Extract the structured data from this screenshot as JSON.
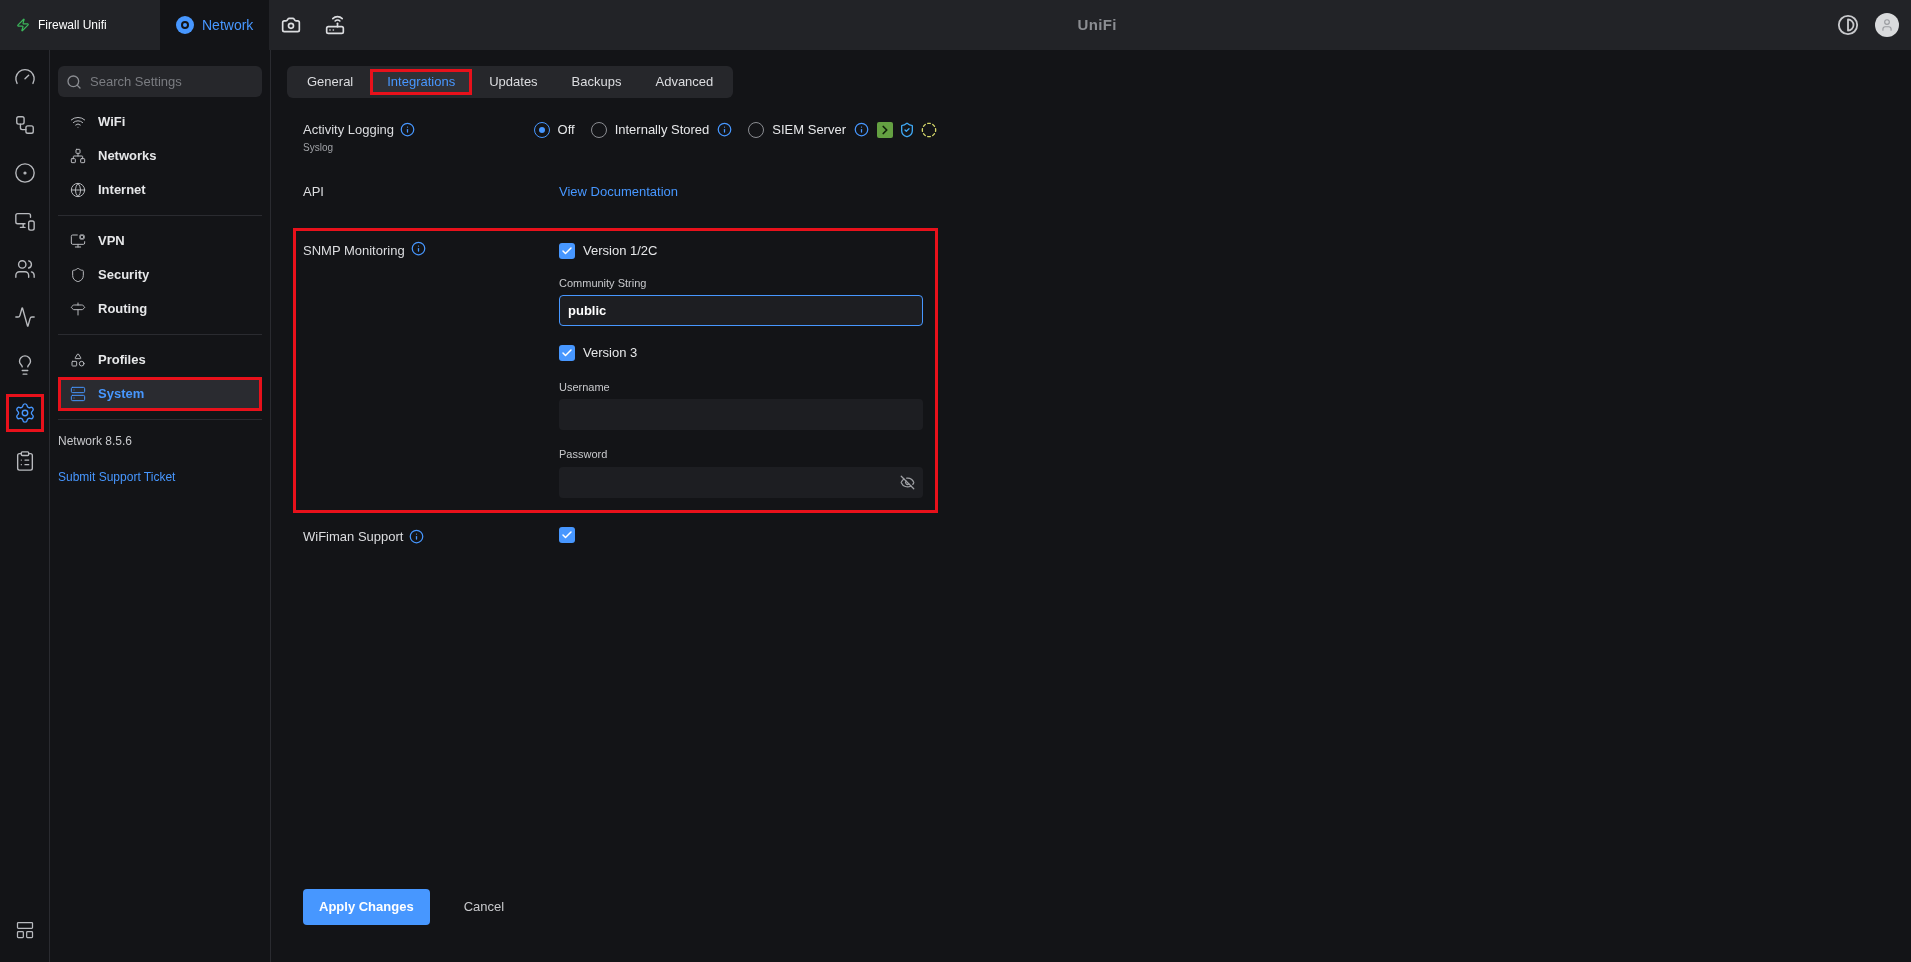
{
  "app_bar": {
    "site": "Firewall Unifi",
    "apps": [
      {
        "kind": "network",
        "label": "Network",
        "selected": true
      },
      {
        "kind": "camera",
        "selected": false
      },
      {
        "kind": "gateway",
        "selected": false
      }
    ],
    "brand": "UniFi"
  },
  "rail": [
    {
      "kind": "dashboard",
      "selected": false,
      "highlighted": false
    },
    {
      "kind": "topology",
      "selected": false,
      "highlighted": false
    },
    {
      "kind": "radio",
      "selected": false,
      "highlighted": false
    },
    {
      "kind": "devices",
      "selected": false,
      "highlighted": false
    },
    {
      "kind": "clients",
      "selected": false,
      "highlighted": false
    },
    {
      "kind": "insights",
      "selected": false,
      "highlighted": false
    },
    {
      "kind": "ideas",
      "selected": false,
      "highlighted": false
    },
    {
      "kind": "settings",
      "selected": true,
      "highlighted": true
    },
    {
      "kind": "logs",
      "selected": false,
      "highlighted": false
    }
  ],
  "rail_bottom": {
    "kind": "floorplan"
  },
  "sidebar": {
    "search": {
      "placeholder": "Search Settings"
    },
    "groups": [
      [
        {
          "kind": "wifi",
          "label": "WiFi",
          "selected": false,
          "highlighted": false
        },
        {
          "kind": "networks",
          "label": "Networks",
          "selected": false,
          "highlighted": false
        },
        {
          "kind": "internet",
          "label": "Internet",
          "selected": false,
          "highlighted": false
        }
      ],
      [
        {
          "kind": "vpn",
          "label": "VPN",
          "selected": false,
          "highlighted": false
        },
        {
          "kind": "security",
          "label": "Security",
          "selected": false,
          "highlighted": false
        },
        {
          "kind": "routing",
          "label": "Routing",
          "selected": false,
          "highlighted": false
        }
      ],
      [
        {
          "kind": "profiles",
          "label": "Profiles",
          "selected": false,
          "highlighted": false
        },
        {
          "kind": "system",
          "label": "System",
          "selected": true,
          "highlighted": true
        }
      ]
    ],
    "version": "Network 8.5.6",
    "support_link": "Submit Support Ticket"
  },
  "tabs": [
    {
      "label": "General",
      "selected": false,
      "highlighted": false
    },
    {
      "label": "Integrations",
      "selected": true,
      "highlighted": true
    },
    {
      "label": "Updates",
      "selected": false,
      "highlighted": false
    },
    {
      "label": "Backups",
      "selected": false,
      "highlighted": false
    },
    {
      "label": "Advanced",
      "selected": false,
      "highlighted": false
    }
  ],
  "activity_logging": {
    "label": "Activity Logging",
    "sublabel": "Syslog",
    "options": [
      {
        "kind": "plain",
        "label": "Off",
        "selected": true
      },
      {
        "kind": "info",
        "label": "Internally Stored",
        "selected": false
      },
      {
        "kind": "siem",
        "label": "SIEM Server",
        "selected": false
      }
    ]
  },
  "api": {
    "label": "API",
    "link": "View Documentation"
  },
  "snmp": {
    "label": "SNMP Monitoring",
    "highlighted": true,
    "v2": {
      "label": "Version 1/2C",
      "checked": true,
      "field_label": "Community String",
      "value": "public",
      "focused": true
    },
    "v3": {
      "label": "Version 3",
      "checked": true,
      "username_label": "Username",
      "password_label": "Password"
    }
  },
  "wifiman": {
    "label": "WiFiman Support",
    "checked": true
  },
  "footer": {
    "apply": "Apply Changes",
    "cancel": "Cancel"
  }
}
